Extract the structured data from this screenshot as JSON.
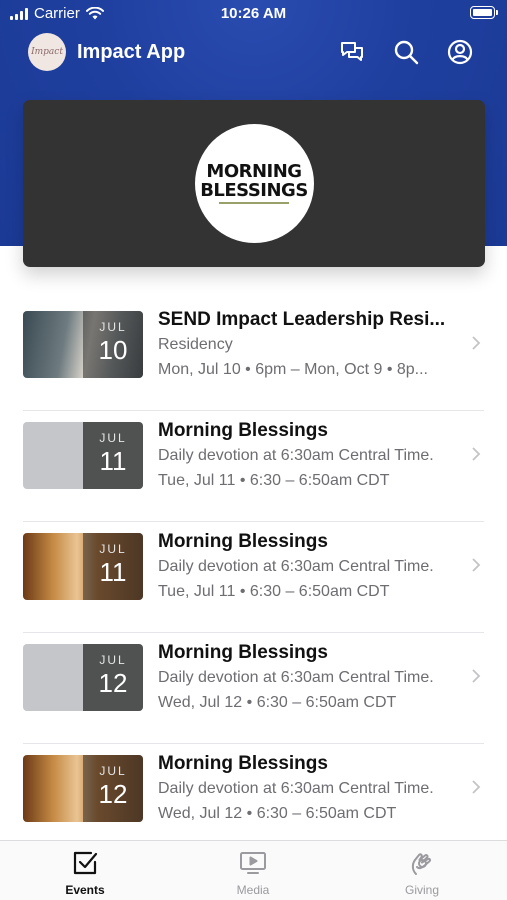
{
  "status_bar": {
    "carrier": "Carrier",
    "time": "10:26 AM"
  },
  "header": {
    "title": "Impact App",
    "logo_text": "Impact",
    "icons": [
      "chat-icon",
      "search-icon",
      "profile-icon"
    ]
  },
  "featured": {
    "line1": "MORNING",
    "line2": "BLESSINGS"
  },
  "events": [
    {
      "title": "SEND Impact Leadership Resi...",
      "subtitle": "Residency",
      "time": "Mon, Jul 10 • 6pm – Mon, Oct 9 • 8p...",
      "month": "JUL",
      "day": "10",
      "thumb": "photo"
    },
    {
      "title": "Morning Blessings",
      "subtitle": "Daily devotion at 6:30am Central Time.",
      "time": "Tue, Jul 11 • 6:30 – 6:50am CDT",
      "month": "JUL",
      "day": "11",
      "thumb": "gray"
    },
    {
      "title": "Morning Blessings",
      "subtitle": "Daily devotion at 6:30am Central Time.",
      "time": "Tue, Jul 11 • 6:30 – 6:50am CDT",
      "month": "JUL",
      "day": "11",
      "thumb": "bread"
    },
    {
      "title": "Morning Blessings",
      "subtitle": "Daily devotion at 6:30am Central Time.",
      "time": "Wed, Jul 12 • 6:30 – 6:50am CDT",
      "month": "JUL",
      "day": "12",
      "thumb": "gray"
    },
    {
      "title": "Morning Blessings",
      "subtitle": "Daily devotion at 6:30am Central Time.",
      "time": "Wed, Jul 12 • 6:30 – 6:50am CDT",
      "month": "JUL",
      "day": "12",
      "thumb": "bread"
    }
  ],
  "tabs": [
    {
      "label": "Events",
      "icon": "checkbox-icon",
      "active": true
    },
    {
      "label": "Media",
      "icon": "play-screen-icon",
      "active": false
    },
    {
      "label": "Giving",
      "icon": "giving-hand-icon",
      "active": false
    }
  ],
  "colors": {
    "header_blue": "#1f3f9f",
    "card_dark": "#333333",
    "text_secondary": "#6d6d72",
    "tab_inactive": "#9a9a9f"
  }
}
